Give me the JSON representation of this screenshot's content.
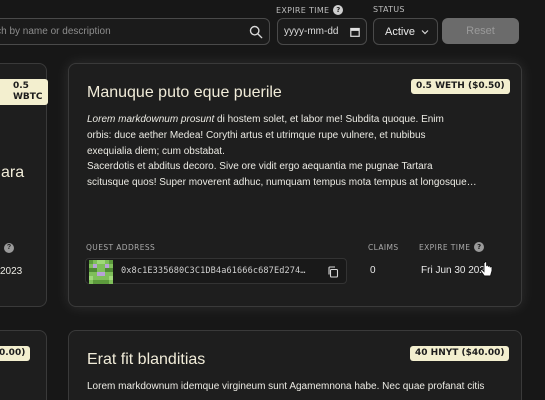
{
  "filters": {
    "search_placeholder": "Search by name or description",
    "expire_label": "EXPIRE TIME",
    "date_placeholder": "yyyy-mm-dd",
    "status_label": "STATUS",
    "status_value": "Active",
    "reset_label": "Reset"
  },
  "left_cards": {
    "top_badge": "0.5 WBTC",
    "top_title_fragment": "ara",
    "top_date_fragment": "2023",
    "bottom_badge": "0.00)"
  },
  "main_card": {
    "badge": "0.5 WETH ($0.50)",
    "title": "Manuque puto eque puerile",
    "desc_italic": "Lorem markdownum prosunt",
    "desc_line1_rest": " di hostem solet, et labor me! Subdita quoque. Enim",
    "desc_line2": "orbis: duce aether Medea! Corythi artus et utrimque rupe vulnere, et nubibus",
    "desc_line3": "exequialia diem; cum obstabat.",
    "desc_line4": "Sacerdotis et abditus decoro. Sive ore vidit ergo aequantia me pugnae Tartara",
    "desc_line5": "scitusque quos! Super moverent adhuc, numquam tempus mota tempus at longosque…",
    "address_label": "QUEST ADDRESS",
    "address": "0x8c1E335680C3C1DB4a61666c687Ed274…",
    "claims_label": "CLAIMS",
    "claims_value": "0",
    "expire_label": "EXPIRE TIME",
    "expire_value": "Fri Jun 30 2023"
  },
  "second_card": {
    "badge": "40 HNYT ($40.00)",
    "title": "Erat fit blanditias",
    "desc_line1": "Lorem markdownum idemque virgineum sunt Agamemnona habe. Nec quae profanat citis"
  },
  "colors": {
    "badge_bg": "#f3efcf",
    "reset_bg": "#6b6b6b",
    "page_bg": "#171717",
    "card_bg": "#1e1e1e"
  },
  "icons": [
    "search-icon",
    "calendar-icon",
    "chevron-down-icon",
    "info-icon",
    "copy-icon",
    "identicon-avatar",
    "pointer-cursor-icon"
  ]
}
